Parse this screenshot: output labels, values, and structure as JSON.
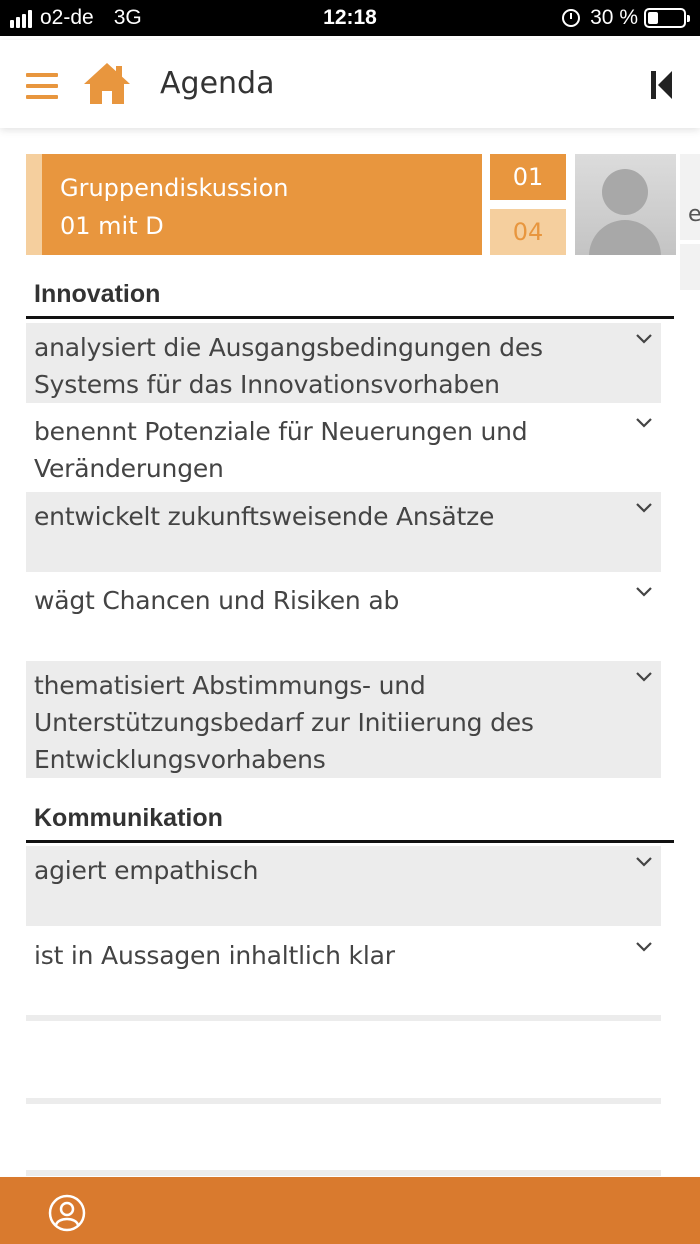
{
  "status_bar": {
    "carrier": "o2-de",
    "network": "3G",
    "time": "12:18",
    "battery": "30 %",
    "battery_level": 0.3
  },
  "header": {
    "title": "Agenda",
    "menu_icon": "hamburger-menu-icon",
    "home_icon": "home-icon",
    "collapse_icon": "skip-back-icon"
  },
  "session": {
    "title": "Gruppendiskussion",
    "subtitle": "01 mit D",
    "current": "01",
    "total": "04",
    "peek_text": "e"
  },
  "sections": [
    {
      "title": "Innovation",
      "items": [
        "analysiert die Ausgangsbedingungen des Systems für das Innovationsvorhaben",
        "benennt Potenziale für Neuerungen und Veränderungen",
        "entwickelt zukunftsweisende Ansätze",
        "wägt Chancen und Risiken ab",
        "thematisiert Abstimmungs- und Unterstützungsbedarf zur Initiierung des Entwicklungsvorhabens"
      ]
    },
    {
      "title": "Kommunikation",
      "items": [
        "agiert empathisch",
        "ist in Aussagen inhaltlich klar"
      ]
    }
  ],
  "colors": {
    "accent": "#e8963e",
    "accent_light": "#f5cf9e",
    "footer": "#d97a2e",
    "row_grey": "#ececec"
  },
  "footer": {
    "user_icon": "user-circle-icon"
  }
}
